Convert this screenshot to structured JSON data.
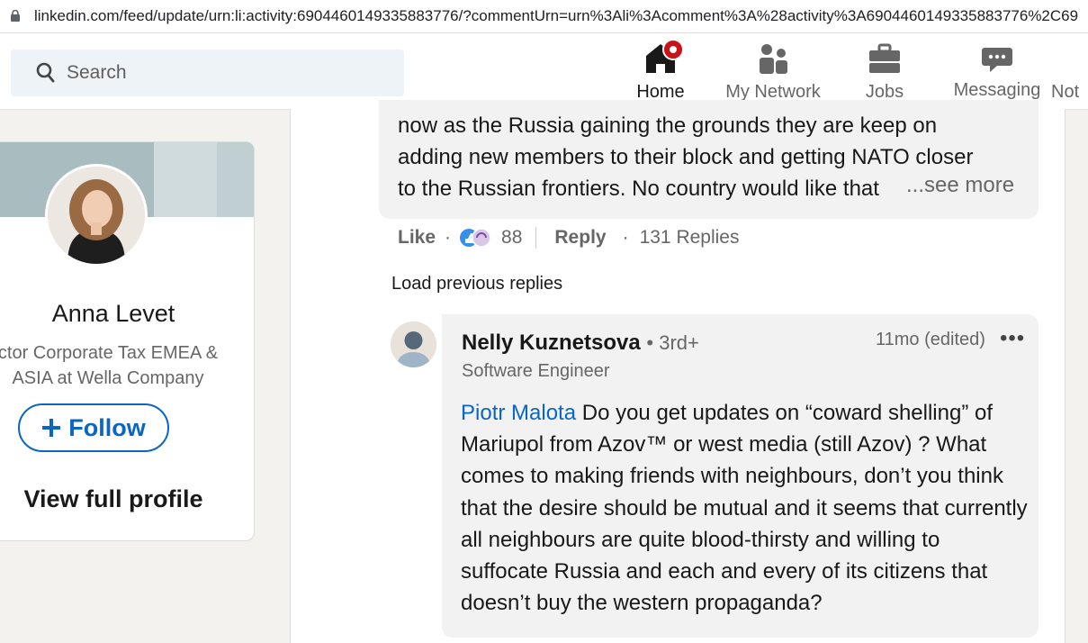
{
  "browser": {
    "url": "linkedin.com/feed/update/urn:li:activity:6904460149335883776/?commentUrn=urn%3Ali%3Acomment%3A%28activity%3A6904460149335883776%2C69"
  },
  "nav": {
    "search_placeholder": "Search",
    "items": [
      {
        "label": "Home",
        "icon": "home-icon",
        "active": true,
        "badge": true
      },
      {
        "label": "My Network",
        "icon": "people-icon"
      },
      {
        "label": "Jobs",
        "icon": "briefcase-icon"
      },
      {
        "label": "Messaging",
        "icon": "chat-icon"
      },
      {
        "label": "Not"
      }
    ],
    "colors": {
      "badge": "#cc1016",
      "accent": "#0a66c2"
    }
  },
  "profile_card": {
    "name": "Anna Levet",
    "headline_line1": "ctor Corporate Tax EMEA &",
    "headline_line2": "ASIA at Wella Company",
    "follow_label": "Follow",
    "view_profile_label": "View full profile"
  },
  "comment": {
    "lines": [
      "now as the Russia gaining the grounds they are keep on",
      "adding new members to their block and getting NATO closer",
      "to the Russian frontiers. No country would like that"
    ],
    "see_more": "...see more",
    "like_label": "Like",
    "reaction_count": "88",
    "reply_label": "Reply",
    "replies_count": "131 Replies",
    "load_previous": "Load previous replies"
  },
  "reply": {
    "author": "Nelly Kuznetsova",
    "degree": "• 3rd+",
    "time": "11mo (edited)",
    "menu": "•••",
    "headline": "Software Engineer",
    "mention": "Piotr Malota",
    "body": " Do you get updates on “coward shelling” of Mariupol from Azov™ or west media (still Azov) ? What comes to making friends with neighbours, don’t you think that the desire should be mutual and it seems that currently all neighbours are quite blood-thirsty and willing to suffocate Russia and each and every of its citizens that doesn’t buy the western propaganda?"
  }
}
